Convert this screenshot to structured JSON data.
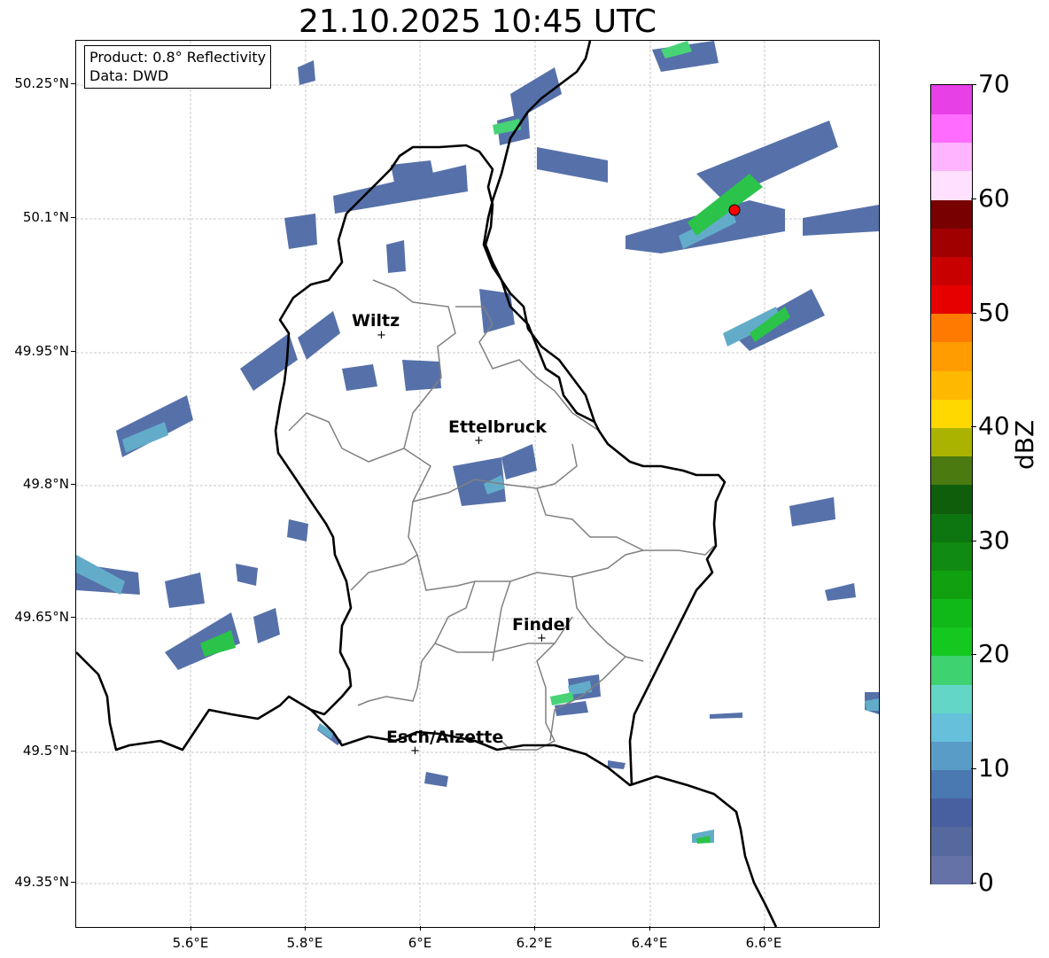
{
  "title": "21.10.2025 10:45 UTC",
  "info": {
    "product": "Product: 0.8° Reflectivity",
    "data": "Data: DWD"
  },
  "axes": {
    "lat_ticks": [
      "50.25°N",
      "50.1°N",
      "49.95°N",
      "49.8°N",
      "49.65°N",
      "49.5°N",
      "49.35°N"
    ],
    "lon_ticks": [
      "5.6°E",
      "5.8°E",
      "6°E",
      "6.2°E",
      "6.4°E",
      "6.6°E"
    ]
  },
  "colorbar": {
    "label": "dBZ",
    "ticks": [
      "0",
      "10",
      "20",
      "30",
      "40",
      "50",
      "60",
      "70"
    ],
    "colors": [
      "#6472a8",
      "#55699f",
      "#4860a0",
      "#4a78b0",
      "#5a9cc8",
      "#66c0dc",
      "#64d6c8",
      "#3ed270",
      "#14c820",
      "#10b818",
      "#10a010",
      "#108a10",
      "#0e7610",
      "#0e5e0c",
      "#4a7a10",
      "#aab400",
      "#ffd800",
      "#ffb800",
      "#ff9c00",
      "#ff7a00",
      "#e60000",
      "#c80000",
      "#a00000",
      "#780000",
      "#ffe0ff",
      "#ffb4ff",
      "#ff6cff",
      "#e640e6"
    ]
  },
  "cities": [
    {
      "name": "Wiltz"
    },
    {
      "name": "Ettelbruck"
    },
    {
      "name": "Findel"
    },
    {
      "name": "Esch/Alzette"
    }
  ],
  "marker_symbol": "+",
  "radar_site_marker": "red-circle"
}
